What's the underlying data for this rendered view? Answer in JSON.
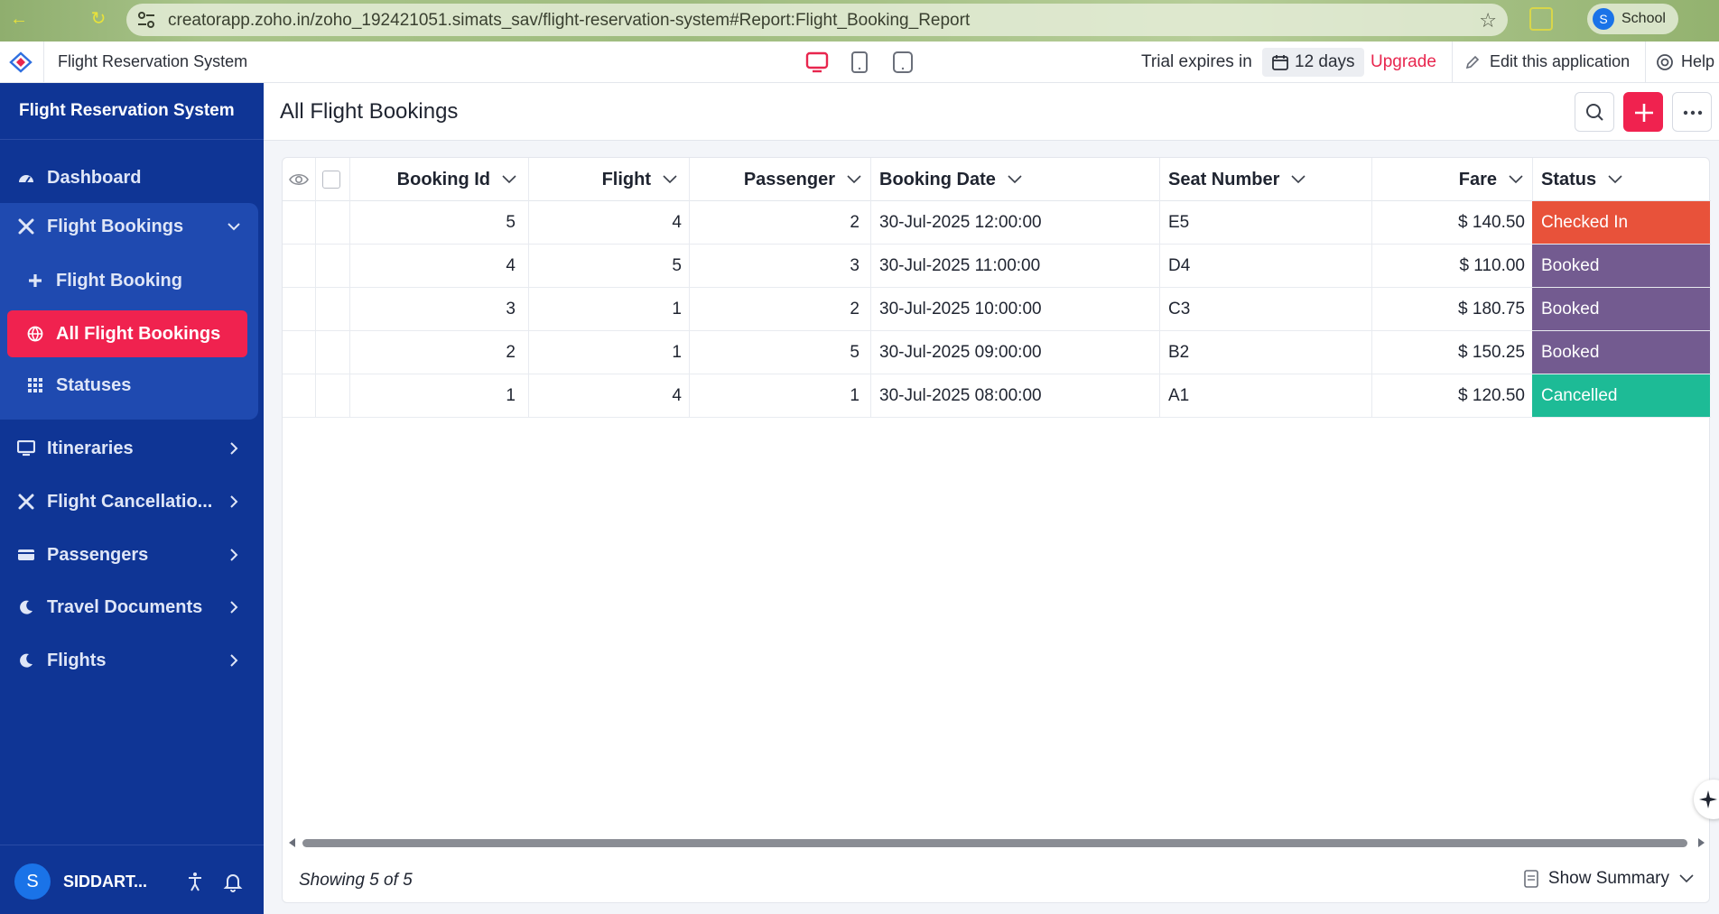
{
  "browser": {
    "url": "creatorapp.zoho.in/zoho_192421051.simats_sav/flight-reservation-system#Report:Flight_Booking_Report",
    "profile_initial": "S",
    "profile_label": "School"
  },
  "header": {
    "app_name": "Flight Reservation System",
    "trial_label": "Trial expires in",
    "trial_days": "12 days",
    "upgrade_label": "Upgrade",
    "edit_label": "Edit this application",
    "help_label": "Help"
  },
  "sidebar": {
    "title": "Flight Reservation System",
    "items": [
      {
        "label": "Dashboard",
        "icon": "dashboard-icon"
      },
      {
        "label": "Flight Bookings",
        "icon": "flight-cross-icon"
      },
      {
        "label": "Flight Booking",
        "icon": "plus-icon"
      },
      {
        "label": "All Flight Bookings",
        "icon": "globe-icon"
      },
      {
        "label": "Statuses",
        "icon": "grid-dots-icon"
      },
      {
        "label": "Itineraries",
        "icon": "monitor-icon"
      },
      {
        "label": "Flight Cancellatio...",
        "icon": "flight-cross-icon"
      },
      {
        "label": "Passengers",
        "icon": "card-icon"
      },
      {
        "label": "Travel Documents",
        "icon": "moon-icon"
      },
      {
        "label": "Flights",
        "icon": "moon-icon"
      }
    ],
    "user": {
      "initial": "S",
      "name": "SIDDART..."
    }
  },
  "page": {
    "title": "All Flight Bookings"
  },
  "table": {
    "columns": [
      "Booking Id",
      "Flight",
      "Passenger",
      "Booking Date",
      "Seat Number",
      "Fare",
      "Status"
    ],
    "rows": [
      {
        "booking_id": "5",
        "flight": "4",
        "passenger": "2",
        "booking_date": "30-Jul-2025 12:00:00",
        "seat": "E5",
        "fare": "$ 140.50",
        "status": "Checked In",
        "status_color": "#e8523a"
      },
      {
        "booking_id": "4",
        "flight": "5",
        "passenger": "3",
        "booking_date": "30-Jul-2025 11:00:00",
        "seat": "D4",
        "fare": "$ 110.00",
        "status": "Booked",
        "status_color": "#735b90"
      },
      {
        "booking_id": "3",
        "flight": "1",
        "passenger": "2",
        "booking_date": "30-Jul-2025 10:00:00",
        "seat": "C3",
        "fare": "$ 180.75",
        "status": "Booked",
        "status_color": "#735b90"
      },
      {
        "booking_id": "2",
        "flight": "1",
        "passenger": "5",
        "booking_date": "30-Jul-2025 09:00:00",
        "seat": "B2",
        "fare": "$ 150.25",
        "status": "Booked",
        "status_color": "#735b90"
      },
      {
        "booking_id": "1",
        "flight": "4",
        "passenger": "1",
        "booking_date": "30-Jul-2025 08:00:00",
        "seat": "A1",
        "fare": "$ 120.50",
        "status": "Cancelled",
        "status_color": "#1dbb96"
      }
    ]
  },
  "footer": {
    "showing": "Showing 5 of 5",
    "summary_label": "Show Summary"
  },
  "colors": {
    "sidebar_bg": "#0f3595",
    "accent": "#f0224f",
    "upgrade": "#e8264e"
  }
}
